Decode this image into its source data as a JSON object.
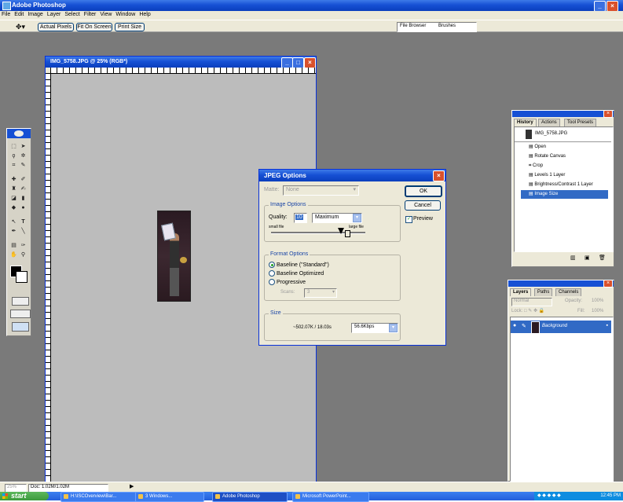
{
  "app": {
    "title": "Adobe Photoshop"
  },
  "menu": [
    "File",
    "Edit",
    "Image",
    "Layer",
    "Select",
    "Filter",
    "View",
    "Window",
    "Help"
  ],
  "options_bar": {
    "buttons": [
      "Actual Pixels",
      "Fit On Screen",
      "Print Size"
    ],
    "tabs": [
      "File Browser",
      "Brushes"
    ]
  },
  "document": {
    "title": "IMG_5758.JPG @ 25% (RGB*)"
  },
  "status_bar": {
    "zoom": "25%",
    "doc_size": "Doc: 1.02M/1.02M"
  },
  "jpeg_dialog": {
    "title": "JPEG Options",
    "matte_label": "Matte:",
    "matte_value": "None",
    "image_options": "Image Options",
    "quality_label": "Quality:",
    "quality_value": "10",
    "quality_preset": "Maximum",
    "slider_min": "small file",
    "slider_max": "large file",
    "slider_value": 0.8,
    "ok": "OK",
    "cancel": "Cancel",
    "preview": "Preview",
    "format_options": "Format Options",
    "formats": [
      "Baseline (\"Standard\")",
      "Baseline Optimized",
      "Progressive"
    ],
    "scans_label": "Scans:",
    "scans_value": "3",
    "size_legend": "Size",
    "size_text": "~502.07K / 18.03s",
    "speed": "56.6Kbps"
  },
  "history_panel": {
    "tabs": [
      "History",
      "Actions",
      "Tool Presets"
    ],
    "snapshot": "IMG_5758.JPG",
    "items": [
      "Open",
      "Rotate Canvas",
      "Crop",
      "Levels 1 Layer",
      "Brightness/Contrast 1 Layer",
      "Image Size"
    ]
  },
  "layers_panel": {
    "tabs": [
      "Layers",
      "Paths",
      "Channels"
    ],
    "blend_mode": "Normal",
    "opacity_label": "Opacity:",
    "opacity": "100%",
    "lock_label": "Lock:",
    "fill_label": "Fill:",
    "fill": "100%",
    "layer_name": "Background"
  },
  "taskbar": {
    "start": "start",
    "items": [
      "H:\\ISCOverview\\Bar...",
      "3 Windows...",
      "Adobe Photoshop",
      "Microsoft PowerPoint..."
    ],
    "clock": "12:45 PM"
  },
  "colors": {
    "titlebar": "#1650d4",
    "workspace": "#7a7a7a",
    "dialog": "#ece9d8",
    "selection": "#316ac5"
  }
}
